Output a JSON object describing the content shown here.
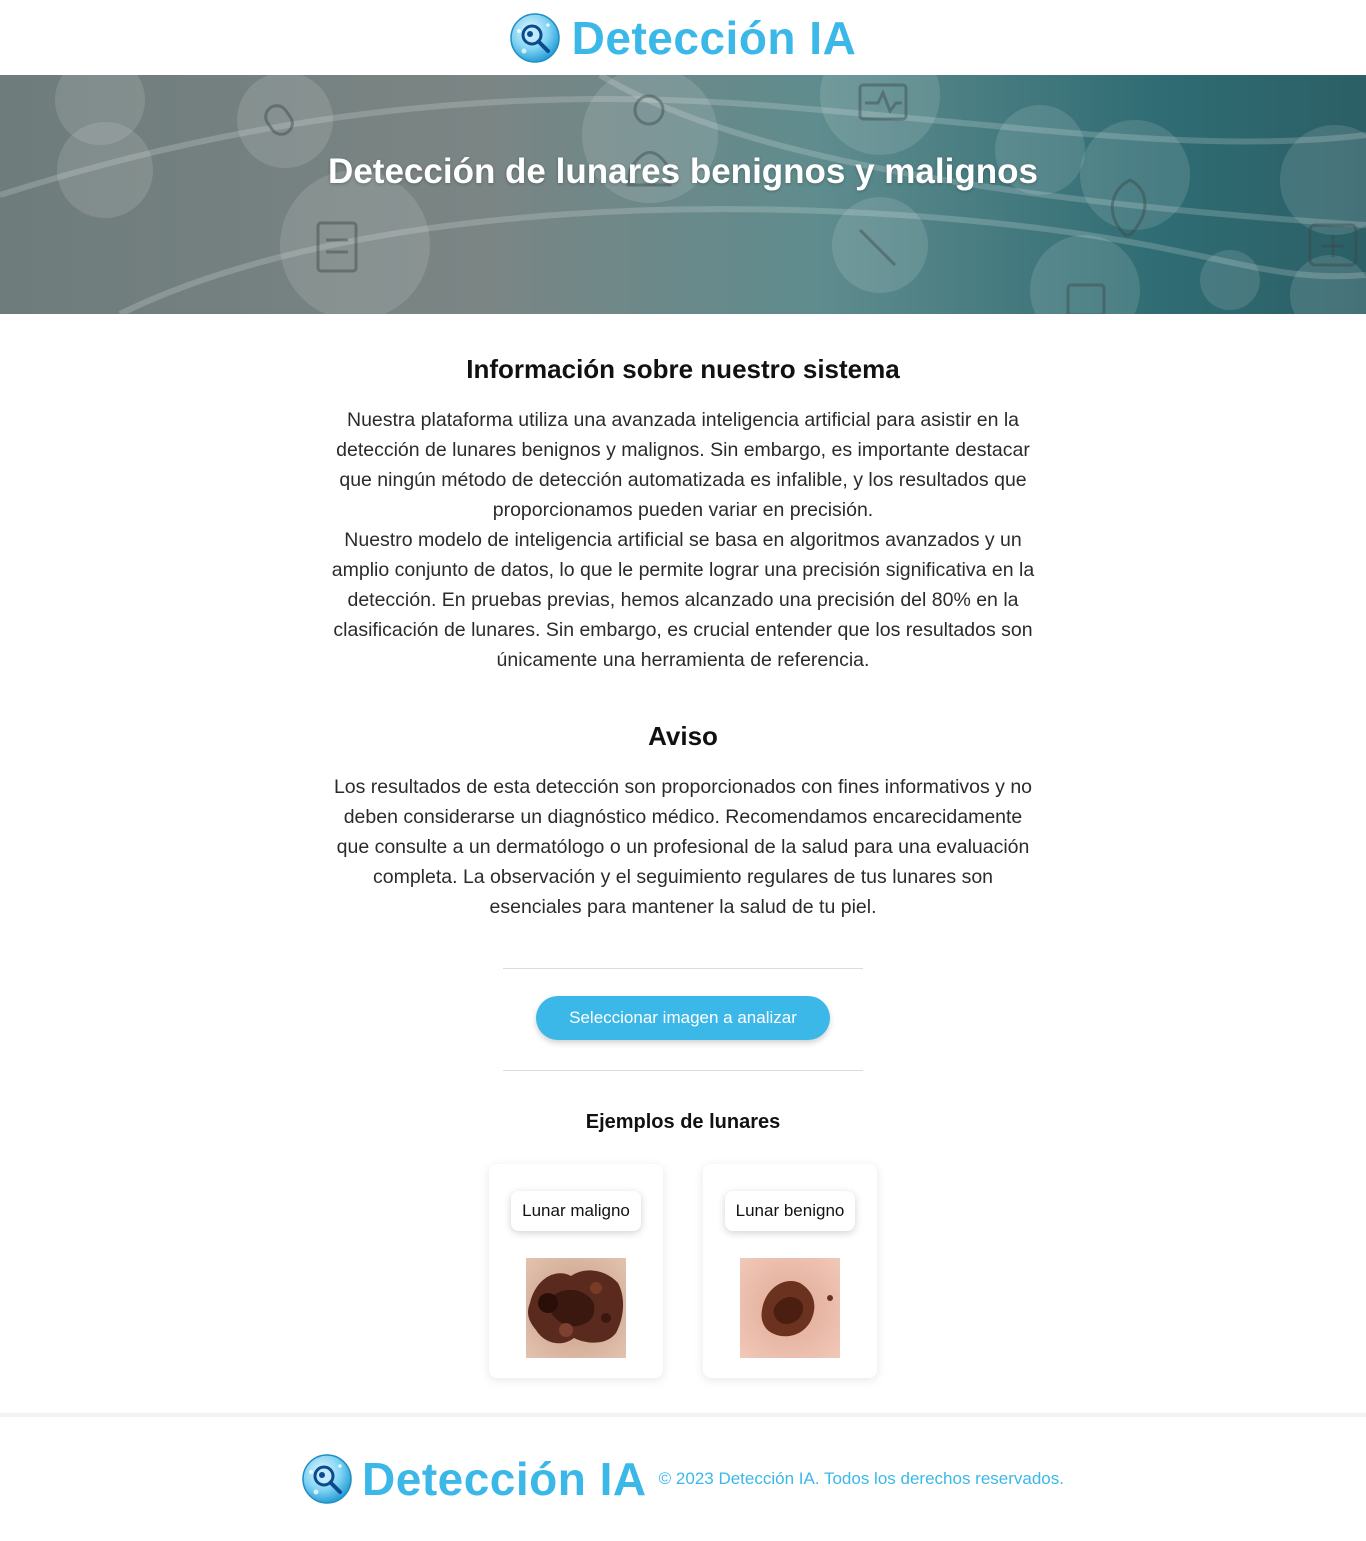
{
  "brand": {
    "title": "Detección IA",
    "logo_icon": "magnifier-cell-icon",
    "accent_color": "#3bb8e8"
  },
  "hero": {
    "title": "Detección de lunares benignos y malignos"
  },
  "info": {
    "title": "Información sobre nuestro sistema",
    "paragraph_1": "Nuestra plataforma utiliza una avanzada inteligencia artificial para asistir en la detección de lunares benignos y malignos. Sin embargo, es importante destacar que ningún método de detección automatizada es infalible, y los resultados que proporcionamos pueden variar en precisión.",
    "paragraph_2": "Nuestro modelo de inteligencia artificial se basa en algoritmos avanzados y un amplio conjunto de datos, lo que le permite lograr una precisión significativa en la detección. En pruebas previas, hemos alcanzado una precisión del 80% en la clasificación de lunares. Sin embargo, es crucial entender que los resultados son únicamente una herramienta de referencia."
  },
  "notice": {
    "title": "Aviso",
    "paragraph": "Los resultados de esta detección son proporcionados con fines informativos y no deben considerarse un diagnóstico médico. Recomendamos encarecidamente que consulte a un dermatólogo o un profesional de la salud para una evaluación completa. La observación y el seguimiento regulares de tus lunares son esenciales para mantener la salud de tu piel."
  },
  "upload": {
    "button_label": "Seleccionar imagen a analizar"
  },
  "examples": {
    "title": "Ejemplos de lunares",
    "items": [
      {
        "label": "Lunar maligno",
        "image": "malignant-mole-photo"
      },
      {
        "label": "Lunar benigno",
        "image": "benign-mole-photo"
      }
    ]
  },
  "footer": {
    "brand": "Detección IA",
    "copyright": "© 2023 Detección IA. Todos los derechos reservados."
  }
}
